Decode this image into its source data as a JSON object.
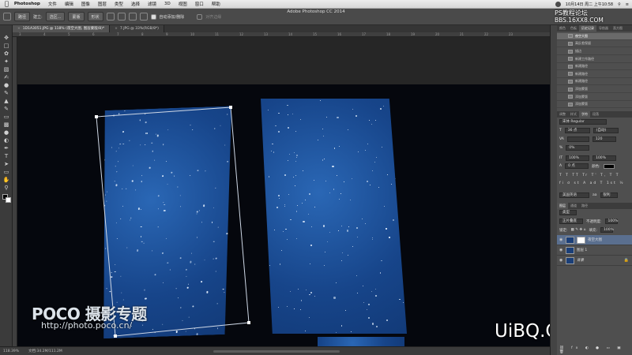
{
  "menubar": {
    "apple": "",
    "app_name": "Photoshop",
    "items": [
      "文件",
      "编辑",
      "图像",
      "图层",
      "类型",
      "选择",
      "滤镜",
      "3D",
      "视图",
      "窗口",
      "帮助"
    ],
    "datetime": "10月14日 周二 上午10:58"
  },
  "window_title": "Adobe Photoshop CC 2014",
  "options_bar": {
    "mode_label": "路径",
    "make_label": "建立:",
    "selection_btn": "选区...",
    "mask_btn": "蒙版",
    "shape_btn": "形状",
    "auto_add_delete": "自动添加/删除",
    "align_edges": "对齐边缘"
  },
  "tabs": [
    {
      "label": "1D1A3051.JPG @ 118% (夜空大图, 图层蒙版/8)*",
      "active": true
    },
    {
      "label": "7.JPG @ 33%(RGB/8*)",
      "active": false
    }
  ],
  "ruler_ticks": [
    "3",
    "4",
    "5",
    "6",
    "7",
    "8",
    "9",
    "10",
    "11",
    "12",
    "13",
    "14",
    "15",
    "16",
    "17",
    "18",
    "19",
    "20",
    "21",
    "22",
    "23"
  ],
  "watermarks": {
    "poco_logo": "POCO",
    "poco_title": "摄影专题",
    "poco_url": "http://photo.poco.cn/",
    "uibq": "UiBQ.CoM",
    "ps_line1": "PS教程论坛",
    "ps_line2": "BBS.16XX8.COM"
  },
  "status": {
    "zoom": "118.39%",
    "doc": "文档:34.2M/111.2M"
  },
  "panels": {
    "history_tabs": [
      "颜色",
      "色板",
      "历史记录",
      "导航器",
      "直方图"
    ],
    "history_items": [
      "夜空大图",
      "高反差保留",
      "描边",
      "新建工作路径",
      "新建路径",
      "新建路径",
      "新建路径",
      "添加蒙版",
      "添加蒙版",
      "添加蒙版"
    ],
    "char_tabs": [
      "调整",
      "样式",
      "字符",
      "段落"
    ],
    "font_name": "宋体 Regular",
    "font_size": "36 点",
    "leading": "(自动)",
    "tracking": "120",
    "baseline": "0%",
    "vscale": "100%",
    "hscale": "100%",
    "shift": "0 点",
    "color_label": "颜色:",
    "lang": "美国英语",
    "aa": "锐利",
    "layer_tabs": [
      "图层",
      "通道",
      "路径"
    ],
    "kind": "类型",
    "blend": "正片叠底",
    "opacity_label": "不透明度:",
    "opacity": "100%",
    "lock_label": "锁定:",
    "fill_label": "填充:",
    "fill": "100%",
    "layers": [
      "夜空大图",
      "图层 1",
      "背景"
    ]
  }
}
